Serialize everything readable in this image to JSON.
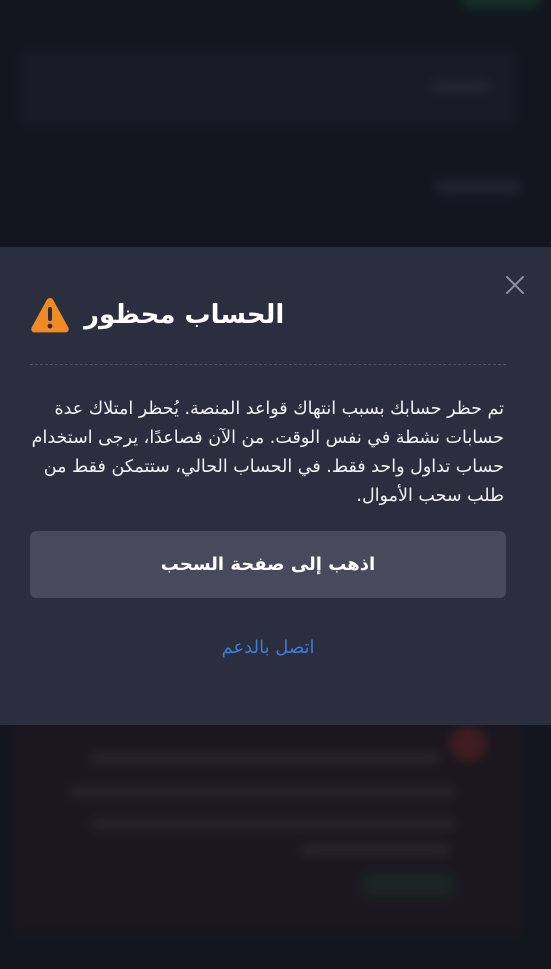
{
  "modal": {
    "title": "الحساب محظور",
    "message": "تم حظر حسابك بسبب انتهاك قواعد المنصة. يُحظر امتلاك عدة حسابات نشطة في نفس الوقت. من الآن فصاعدًا، يرجى استخدام حساب تداول واحد فقط. في الحساب الحالي، ستتمكن فقط من طلب سحب الأموال.",
    "primary_button_label": "اذهب إلى صفحة السحب",
    "support_link_label": "اتصل بالدعم",
    "icons": {
      "warning": "warning-triangle-icon",
      "close": "close-icon"
    }
  },
  "colors": {
    "accent_warning": "#f08a24",
    "link": "#3e7bd6",
    "modal_background": "#2a2e3e",
    "button_background": "#464a5b"
  }
}
